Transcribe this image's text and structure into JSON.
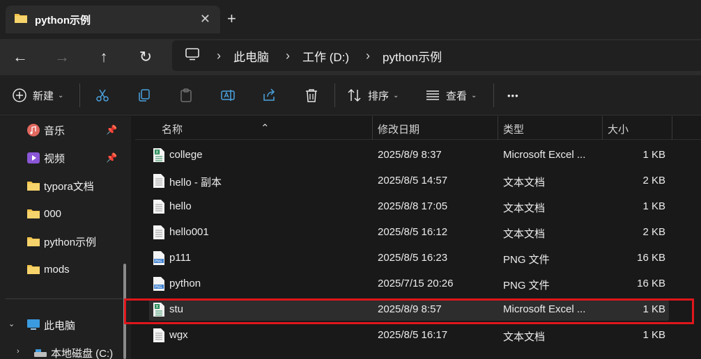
{
  "tab": {
    "title": "python示例",
    "close": "✕",
    "new_tab": "+"
  },
  "nav": {
    "back": "←",
    "forward": "→",
    "up": "↑",
    "refresh": "↻"
  },
  "breadcrumb": {
    "items": [
      "此电脑",
      "工作 (D:)",
      "python示例"
    ],
    "separator": "›"
  },
  "toolbar": {
    "new_label": "新建",
    "sort_label": "排序",
    "view_label": "查看",
    "more_label": "•••"
  },
  "sidebar": {
    "items": [
      {
        "label": "音乐",
        "icon": "music-icon",
        "pinned": true
      },
      {
        "label": "视频",
        "icon": "video-icon",
        "pinned": true
      },
      {
        "label": "typora文档",
        "icon": "folder-icon"
      },
      {
        "label": "000",
        "icon": "folder-icon"
      },
      {
        "label": "python示例",
        "icon": "folder-icon"
      },
      {
        "label": "mods",
        "icon": "folder-icon"
      }
    ],
    "this_pc": "此电脑",
    "local_disk": "本地磁盘 (C:)"
  },
  "columns": {
    "name": "名称",
    "modified": "修改日期",
    "type": "类型",
    "size": "大小"
  },
  "files": [
    {
      "name": "college",
      "date": "2025/8/9 8:37",
      "type": "Microsoft Excel ...",
      "size": "1 KB",
      "icon": "excel-file-icon"
    },
    {
      "name": "hello - 副本",
      "date": "2025/8/5 14:57",
      "type": "文本文档",
      "size": "2 KB",
      "icon": "text-file-icon"
    },
    {
      "name": "hello",
      "date": "2025/8/8 17:05",
      "type": "文本文档",
      "size": "1 KB",
      "icon": "text-file-icon"
    },
    {
      "name": "hello001",
      "date": "2025/8/5 16:12",
      "type": "文本文档",
      "size": "2 KB",
      "icon": "text-file-icon"
    },
    {
      "name": "p111",
      "date": "2025/8/5 16:23",
      "type": "PNG 文件",
      "size": "16 KB",
      "icon": "png-file-icon"
    },
    {
      "name": "python",
      "date": "2025/7/15 20:26",
      "type": "PNG 文件",
      "size": "16 KB",
      "icon": "png-file-icon"
    },
    {
      "name": "stu",
      "date": "2025/8/9 8:57",
      "type": "Microsoft Excel ...",
      "size": "1 KB",
      "icon": "excel-file-icon",
      "selected": true
    },
    {
      "name": "wgx",
      "date": "2025/8/5 16:17",
      "type": "文本文档",
      "size": "1 KB",
      "icon": "text-file-icon"
    }
  ],
  "colors": {
    "highlight": "#e0161b",
    "folder": "#f2c44b",
    "accent": "#4aa3df"
  }
}
